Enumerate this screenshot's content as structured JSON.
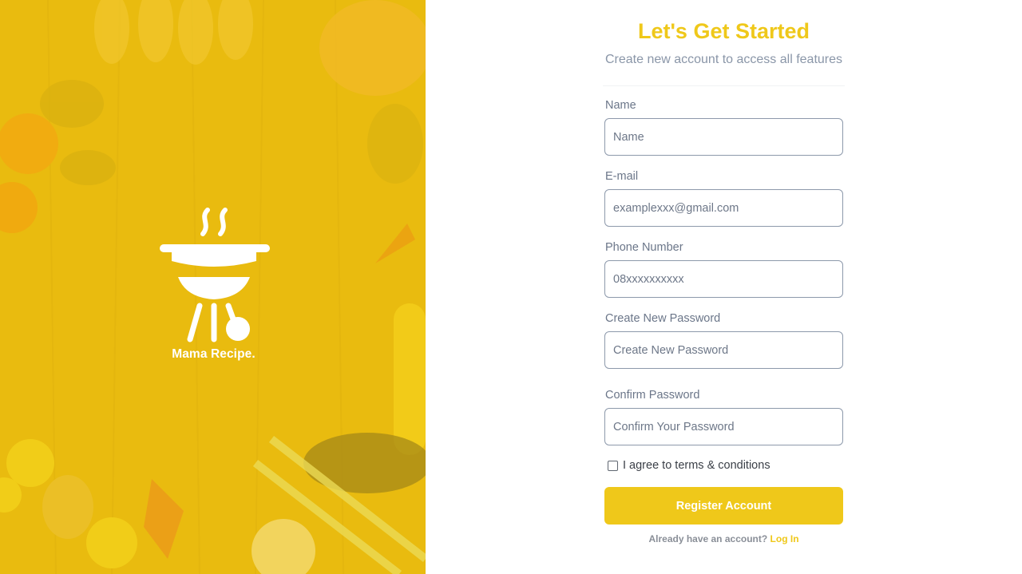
{
  "hero": {
    "brand_name": "Mama Recipe.",
    "logo_icon": "grill-icon",
    "accent_color": "#efc81a"
  },
  "form": {
    "title": "Let's Get Started",
    "subtitle": "Create new account to access all features",
    "fields": [
      {
        "label": "Name",
        "placeholder": "Name",
        "value": ""
      },
      {
        "label": "E-mail",
        "placeholder": "examplexxx@gmail.com",
        "value": ""
      },
      {
        "label": "Phone Number",
        "placeholder": "08xxxxxxxxxx",
        "value": ""
      },
      {
        "label": "Create New Password",
        "placeholder": "Create New Password",
        "value": ""
      },
      {
        "label": "Confirm Password",
        "placeholder": "Confirm Your Password",
        "value": ""
      }
    ],
    "terms_label": "I agree to terms & conditions",
    "terms_checked": false,
    "register_label": "Register Account",
    "login_prompt": "Already have an account?",
    "login_link": "Log In"
  }
}
